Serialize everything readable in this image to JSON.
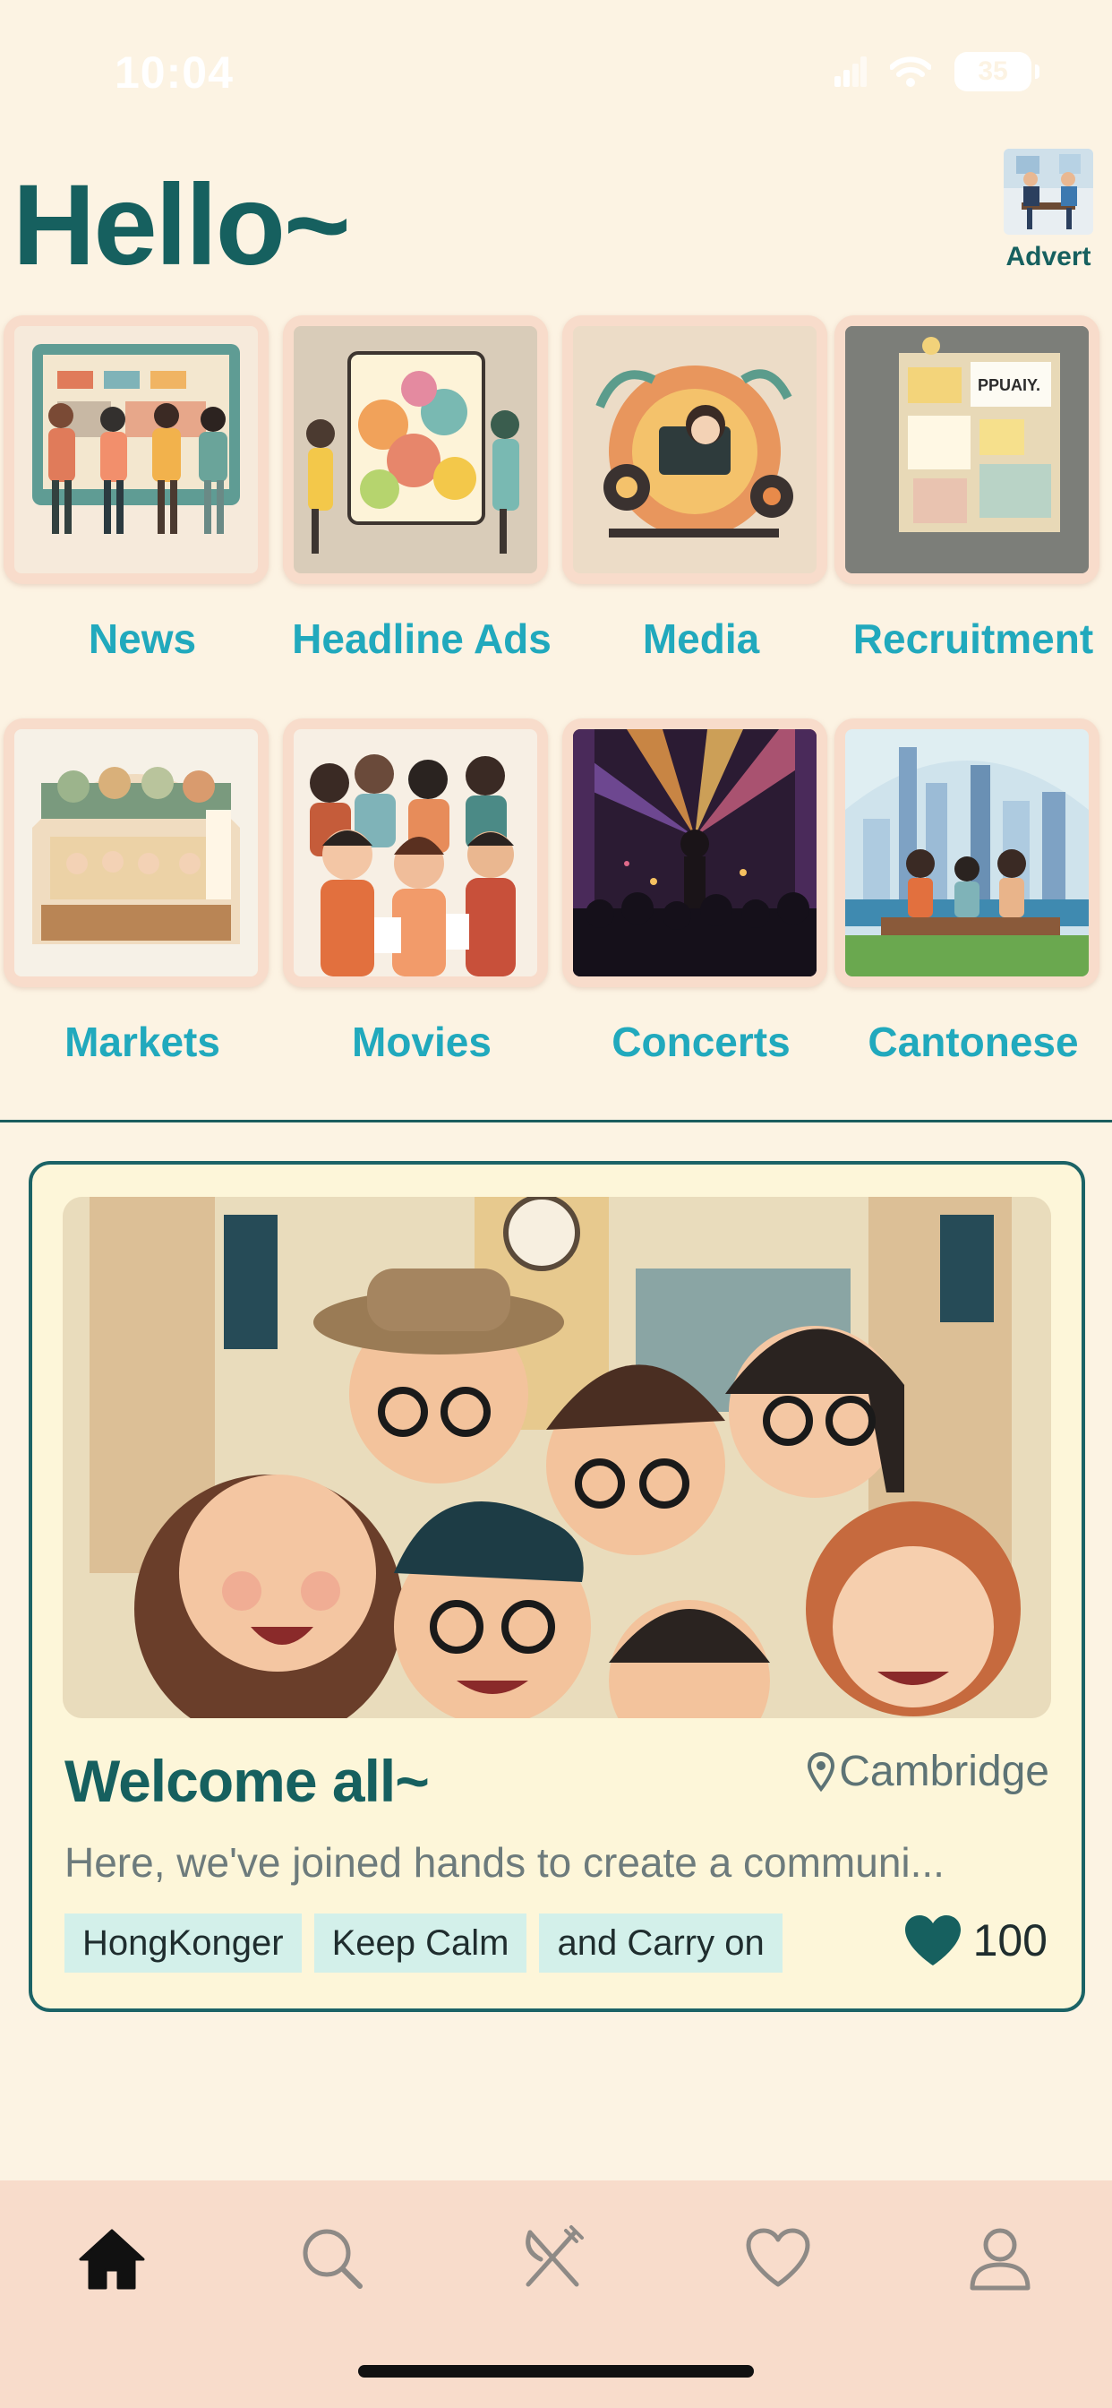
{
  "status_bar": {
    "time": "10:04",
    "battery": "35"
  },
  "header": {
    "greeting": "Hello~",
    "advert_label": "Advert"
  },
  "categories": [
    {
      "label": "News",
      "icon": "news-illustration"
    },
    {
      "label": "Headline Ads",
      "icon": "headline-ads-illustration"
    },
    {
      "label": "Media",
      "icon": "media-illustration"
    },
    {
      "label": "Recruitment",
      "icon": "recruitment-illustration"
    },
    {
      "label": "Markets",
      "icon": "markets-illustration"
    },
    {
      "label": "Movies",
      "icon": "movies-illustration"
    },
    {
      "label": "Concerts",
      "icon": "concerts-illustration"
    },
    {
      "label": "Cantonese",
      "icon": "cantonese-illustration"
    }
  ],
  "post": {
    "title": "Welcome all~",
    "location": "Cambridge",
    "description": "Here, we've joined hands to create a communi...",
    "tags": [
      "HongKonger",
      "Keep Calm",
      "and Carry on"
    ],
    "likes": "100"
  },
  "tabbar": {
    "items": [
      {
        "name": "home",
        "active": true
      },
      {
        "name": "search",
        "active": false
      },
      {
        "name": "dining",
        "active": false
      },
      {
        "name": "favorites",
        "active": false
      },
      {
        "name": "profile",
        "active": false
      }
    ]
  },
  "colors": {
    "background": "#fcf3e3",
    "brand": "#16605f",
    "category_label": "#21a9bd",
    "tile_frame": "#f8dccb",
    "tag_bg": "#d3f0ea",
    "tabbar_bg": "#f8dccb"
  }
}
